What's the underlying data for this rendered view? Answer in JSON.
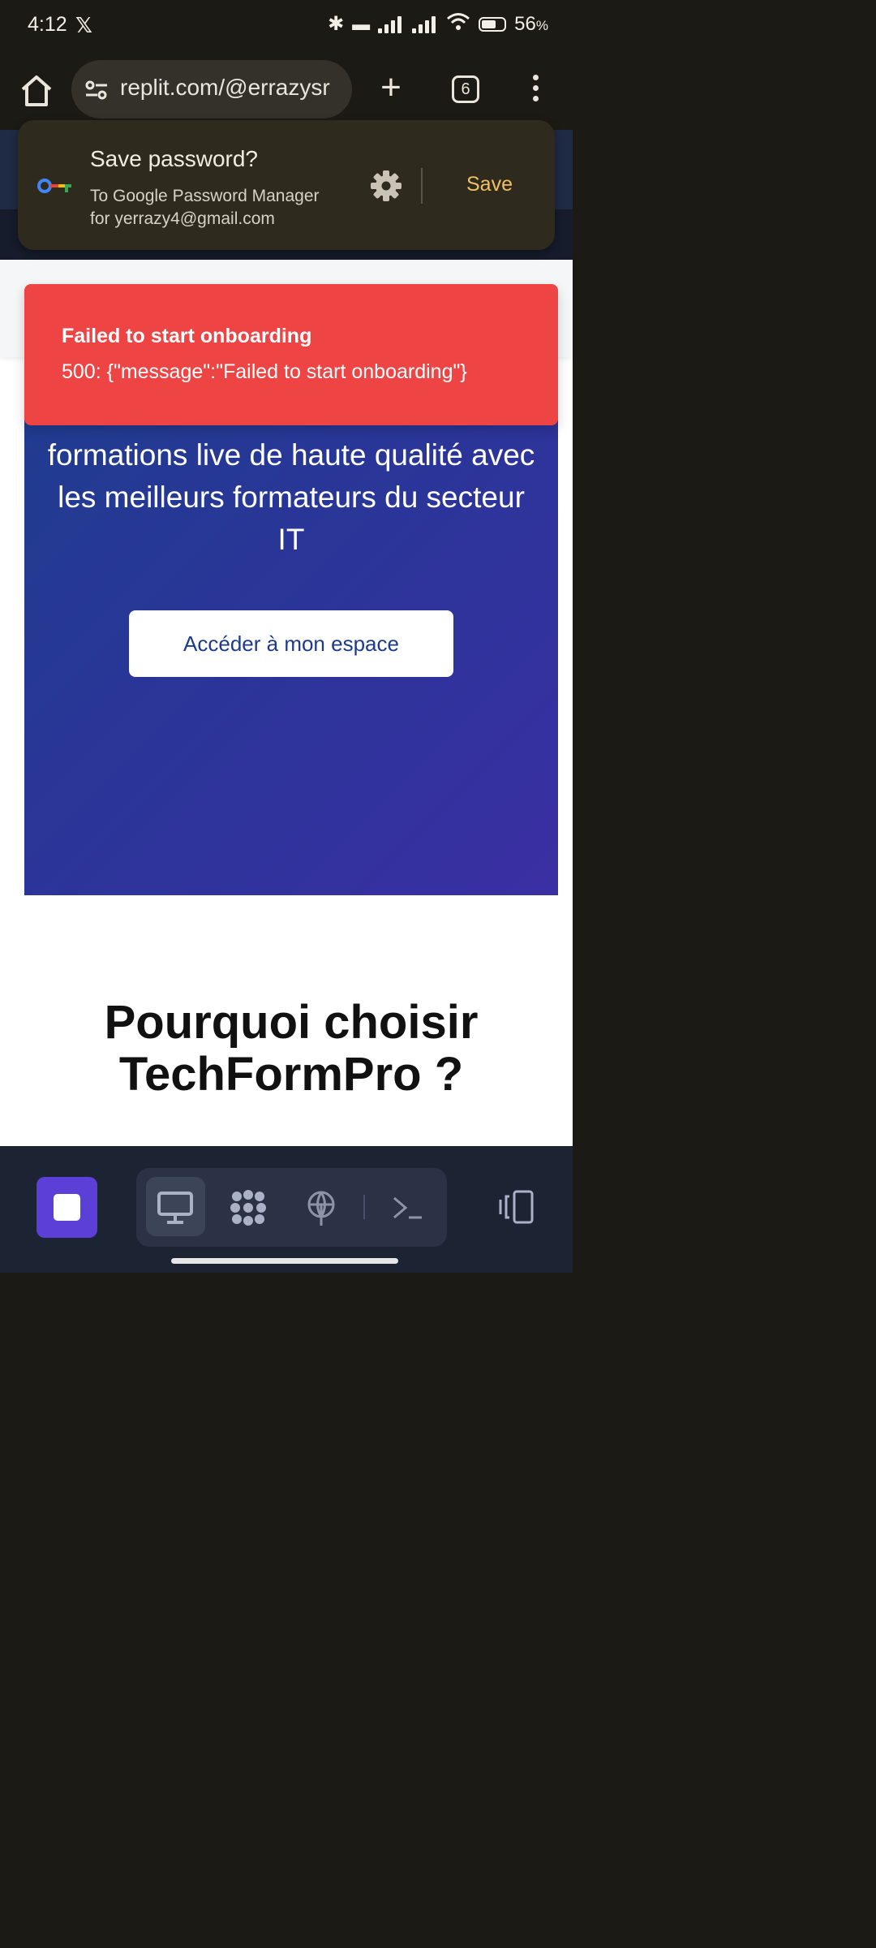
{
  "status_bar": {
    "time": "4:12",
    "battery": "56",
    "battery_unit": "%"
  },
  "browser": {
    "url": "replit.com/@errazysr",
    "tab_count": "6"
  },
  "save_password": {
    "title": "Save password?",
    "subtitle_line1": "To Google Password Manager",
    "subtitle_line2": "for yerrazy4@gmail.com",
    "save_label": "Save"
  },
  "toast": {
    "title": "Failed to start onboarding",
    "message": "500: {\"message\":\"Failed to start onboarding\"}"
  },
  "hero": {
    "text": "formations live de haute qualité avec les meilleurs formateurs du secteur IT",
    "cta_label": "Accéder à mon espace"
  },
  "section": {
    "title": "Pourquoi choisir TechFormPro ?"
  },
  "colors": {
    "toast_bg": "#ef4444",
    "save_accent": "#f0c060",
    "stop_button": "#5b3fd6"
  }
}
